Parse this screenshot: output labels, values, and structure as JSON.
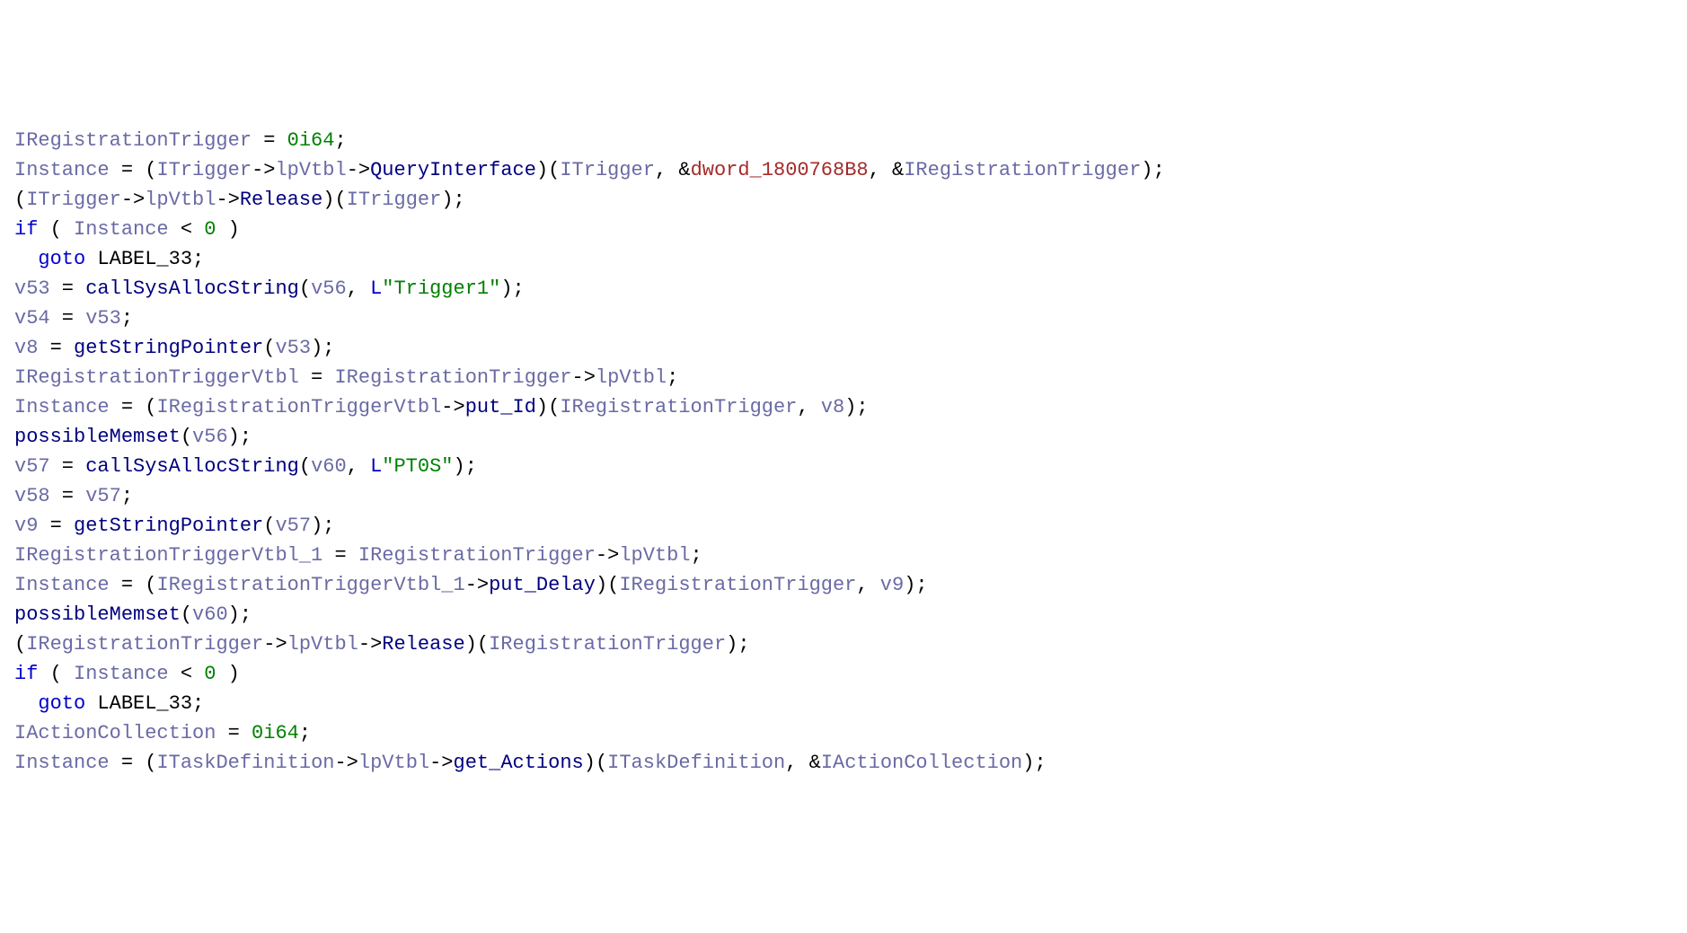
{
  "code": {
    "lines": [
      [
        {
          "cls": "tok-ident-var",
          "t": "IRegistrationTrigger"
        },
        {
          "cls": "tok-op",
          "t": " = "
        },
        {
          "cls": "tok-number",
          "t": "0i64"
        },
        {
          "cls": "tok-punct",
          "t": ";"
        }
      ],
      [
        {
          "cls": "tok-ident-var",
          "t": "Instance"
        },
        {
          "cls": "tok-op",
          "t": " = "
        },
        {
          "cls": "tok-punct",
          "t": "("
        },
        {
          "cls": "tok-ident-var",
          "t": "ITrigger"
        },
        {
          "cls": "tok-op",
          "t": "->"
        },
        {
          "cls": "tok-member",
          "t": "lpVtbl"
        },
        {
          "cls": "tok-op",
          "t": "->"
        },
        {
          "cls": "tok-ident-func",
          "t": "QueryInterface"
        },
        {
          "cls": "tok-punct",
          "t": ")("
        },
        {
          "cls": "tok-ident-var",
          "t": "ITrigger"
        },
        {
          "cls": "tok-punct",
          "t": ", "
        },
        {
          "cls": "tok-op",
          "t": "&"
        },
        {
          "cls": "tok-global",
          "t": "dword_1800768B8"
        },
        {
          "cls": "tok-punct",
          "t": ", "
        },
        {
          "cls": "tok-op",
          "t": "&"
        },
        {
          "cls": "tok-ident-var",
          "t": "IRegistrationTrigger"
        },
        {
          "cls": "tok-punct",
          "t": ");"
        }
      ],
      [
        {
          "cls": "tok-punct",
          "t": "("
        },
        {
          "cls": "tok-ident-var",
          "t": "ITrigger"
        },
        {
          "cls": "tok-op",
          "t": "->"
        },
        {
          "cls": "tok-member",
          "t": "lpVtbl"
        },
        {
          "cls": "tok-op",
          "t": "->"
        },
        {
          "cls": "tok-ident-func",
          "t": "Release"
        },
        {
          "cls": "tok-punct",
          "t": ")("
        },
        {
          "cls": "tok-ident-var",
          "t": "ITrigger"
        },
        {
          "cls": "tok-punct",
          "t": ");"
        }
      ],
      [
        {
          "cls": "tok-keyword",
          "t": "if"
        },
        {
          "cls": "tok-punct",
          "t": " ( "
        },
        {
          "cls": "tok-ident-var",
          "t": "Instance"
        },
        {
          "cls": "tok-op",
          "t": " < "
        },
        {
          "cls": "tok-number",
          "t": "0"
        },
        {
          "cls": "tok-punct",
          "t": " )"
        }
      ],
      [
        {
          "cls": "tok-punct",
          "t": "  "
        },
        {
          "cls": "tok-keyword",
          "t": "goto"
        },
        {
          "cls": "tok-punct",
          "t": " "
        },
        {
          "cls": "tok-label",
          "t": "LABEL_33"
        },
        {
          "cls": "tok-punct",
          "t": ";"
        }
      ],
      [
        {
          "cls": "tok-ident-var",
          "t": "v53"
        },
        {
          "cls": "tok-op",
          "t": " = "
        },
        {
          "cls": "tok-ident-func",
          "t": "callSysAllocString"
        },
        {
          "cls": "tok-punct",
          "t": "("
        },
        {
          "cls": "tok-ident-var",
          "t": "v56"
        },
        {
          "cls": "tok-punct",
          "t": ", "
        },
        {
          "cls": "tok-strprefix",
          "t": "L"
        },
        {
          "cls": "tok-string",
          "t": "\"Trigger1\""
        },
        {
          "cls": "tok-punct",
          "t": ");"
        }
      ],
      [
        {
          "cls": "tok-ident-var",
          "t": "v54"
        },
        {
          "cls": "tok-op",
          "t": " = "
        },
        {
          "cls": "tok-ident-var",
          "t": "v53"
        },
        {
          "cls": "tok-punct",
          "t": ";"
        }
      ],
      [
        {
          "cls": "tok-ident-var",
          "t": "v8"
        },
        {
          "cls": "tok-op",
          "t": " = "
        },
        {
          "cls": "tok-ident-func",
          "t": "getStringPointer"
        },
        {
          "cls": "tok-punct",
          "t": "("
        },
        {
          "cls": "tok-ident-var",
          "t": "v53"
        },
        {
          "cls": "tok-punct",
          "t": ");"
        }
      ],
      [
        {
          "cls": "tok-ident-var",
          "t": "IRegistrationTriggerVtbl"
        },
        {
          "cls": "tok-op",
          "t": " = "
        },
        {
          "cls": "tok-ident-var",
          "t": "IRegistrationTrigger"
        },
        {
          "cls": "tok-op",
          "t": "->"
        },
        {
          "cls": "tok-member",
          "t": "lpVtbl"
        },
        {
          "cls": "tok-punct",
          "t": ";"
        }
      ],
      [
        {
          "cls": "tok-ident-var",
          "t": "Instance"
        },
        {
          "cls": "tok-op",
          "t": " = "
        },
        {
          "cls": "tok-punct",
          "t": "("
        },
        {
          "cls": "tok-ident-var",
          "t": "IRegistrationTriggerVtbl"
        },
        {
          "cls": "tok-op",
          "t": "->"
        },
        {
          "cls": "tok-ident-func",
          "t": "put_Id"
        },
        {
          "cls": "tok-punct",
          "t": ")("
        },
        {
          "cls": "tok-ident-var",
          "t": "IRegistrationTrigger"
        },
        {
          "cls": "tok-punct",
          "t": ", "
        },
        {
          "cls": "tok-ident-var",
          "t": "v8"
        },
        {
          "cls": "tok-punct",
          "t": ");"
        }
      ],
      [
        {
          "cls": "tok-ident-func",
          "t": "possibleMemset"
        },
        {
          "cls": "tok-punct",
          "t": "("
        },
        {
          "cls": "tok-ident-var",
          "t": "v56"
        },
        {
          "cls": "tok-punct",
          "t": ");"
        }
      ],
      [
        {
          "cls": "tok-ident-var",
          "t": "v57"
        },
        {
          "cls": "tok-op",
          "t": " = "
        },
        {
          "cls": "tok-ident-func",
          "t": "callSysAllocString"
        },
        {
          "cls": "tok-punct",
          "t": "("
        },
        {
          "cls": "tok-ident-var",
          "t": "v60"
        },
        {
          "cls": "tok-punct",
          "t": ", "
        },
        {
          "cls": "tok-strprefix",
          "t": "L"
        },
        {
          "cls": "tok-string",
          "t": "\"PT0S\""
        },
        {
          "cls": "tok-punct",
          "t": ");"
        }
      ],
      [
        {
          "cls": "tok-ident-var",
          "t": "v58"
        },
        {
          "cls": "tok-op",
          "t": " = "
        },
        {
          "cls": "tok-ident-var",
          "t": "v57"
        },
        {
          "cls": "tok-punct",
          "t": ";"
        }
      ],
      [
        {
          "cls": "tok-ident-var",
          "t": "v9"
        },
        {
          "cls": "tok-op",
          "t": " = "
        },
        {
          "cls": "tok-ident-func",
          "t": "getStringPointer"
        },
        {
          "cls": "tok-punct",
          "t": "("
        },
        {
          "cls": "tok-ident-var",
          "t": "v57"
        },
        {
          "cls": "tok-punct",
          "t": ");"
        }
      ],
      [
        {
          "cls": "tok-ident-var",
          "t": "IRegistrationTriggerVtbl_1"
        },
        {
          "cls": "tok-op",
          "t": " = "
        },
        {
          "cls": "tok-ident-var",
          "t": "IRegistrationTrigger"
        },
        {
          "cls": "tok-op",
          "t": "->"
        },
        {
          "cls": "tok-member",
          "t": "lpVtbl"
        },
        {
          "cls": "tok-punct",
          "t": ";"
        }
      ],
      [
        {
          "cls": "tok-ident-var",
          "t": "Instance"
        },
        {
          "cls": "tok-op",
          "t": " = "
        },
        {
          "cls": "tok-punct",
          "t": "("
        },
        {
          "cls": "tok-ident-var",
          "t": "IRegistrationTriggerVtbl_1"
        },
        {
          "cls": "tok-op",
          "t": "->"
        },
        {
          "cls": "tok-ident-func",
          "t": "put_Delay"
        },
        {
          "cls": "tok-punct",
          "t": ")("
        },
        {
          "cls": "tok-ident-var",
          "t": "IRegistrationTrigger"
        },
        {
          "cls": "tok-punct",
          "t": ", "
        },
        {
          "cls": "tok-ident-var",
          "t": "v9"
        },
        {
          "cls": "tok-punct",
          "t": ");"
        }
      ],
      [
        {
          "cls": "tok-ident-func",
          "t": "possibleMemset"
        },
        {
          "cls": "tok-punct",
          "t": "("
        },
        {
          "cls": "tok-ident-var",
          "t": "v60"
        },
        {
          "cls": "tok-punct",
          "t": ");"
        }
      ],
      [
        {
          "cls": "tok-punct",
          "t": "("
        },
        {
          "cls": "tok-ident-var",
          "t": "IRegistrationTrigger"
        },
        {
          "cls": "tok-op",
          "t": "->"
        },
        {
          "cls": "tok-member",
          "t": "lpVtbl"
        },
        {
          "cls": "tok-op",
          "t": "->"
        },
        {
          "cls": "tok-ident-func",
          "t": "Release"
        },
        {
          "cls": "tok-punct",
          "t": ")("
        },
        {
          "cls": "tok-ident-var",
          "t": "IRegistrationTrigger"
        },
        {
          "cls": "tok-punct",
          "t": ");"
        }
      ],
      [
        {
          "cls": "tok-keyword",
          "t": "if"
        },
        {
          "cls": "tok-punct",
          "t": " ( "
        },
        {
          "cls": "tok-ident-var",
          "t": "Instance"
        },
        {
          "cls": "tok-op",
          "t": " < "
        },
        {
          "cls": "tok-number",
          "t": "0"
        },
        {
          "cls": "tok-punct",
          "t": " )"
        }
      ],
      [
        {
          "cls": "tok-punct",
          "t": "  "
        },
        {
          "cls": "tok-keyword",
          "t": "goto"
        },
        {
          "cls": "tok-punct",
          "t": " "
        },
        {
          "cls": "tok-label",
          "t": "LABEL_33"
        },
        {
          "cls": "tok-punct",
          "t": ";"
        }
      ],
      [
        {
          "cls": "tok-ident-var",
          "t": "IActionCollection"
        },
        {
          "cls": "tok-op",
          "t": " = "
        },
        {
          "cls": "tok-number",
          "t": "0i64"
        },
        {
          "cls": "tok-punct",
          "t": ";"
        }
      ],
      [
        {
          "cls": "tok-ident-var",
          "t": "Instance"
        },
        {
          "cls": "tok-op",
          "t": " = "
        },
        {
          "cls": "tok-punct",
          "t": "("
        },
        {
          "cls": "tok-ident-var",
          "t": "ITaskDefinition"
        },
        {
          "cls": "tok-op",
          "t": "->"
        },
        {
          "cls": "tok-member",
          "t": "lpVtbl"
        },
        {
          "cls": "tok-op",
          "t": "->"
        },
        {
          "cls": "tok-ident-func",
          "t": "get_Actions"
        },
        {
          "cls": "tok-punct",
          "t": ")("
        },
        {
          "cls": "tok-ident-var",
          "t": "ITaskDefinition"
        },
        {
          "cls": "tok-punct",
          "t": ", "
        },
        {
          "cls": "tok-op",
          "t": "&"
        },
        {
          "cls": "tok-ident-var",
          "t": "IActionCollection"
        },
        {
          "cls": "tok-punct",
          "t": ");"
        }
      ]
    ]
  }
}
